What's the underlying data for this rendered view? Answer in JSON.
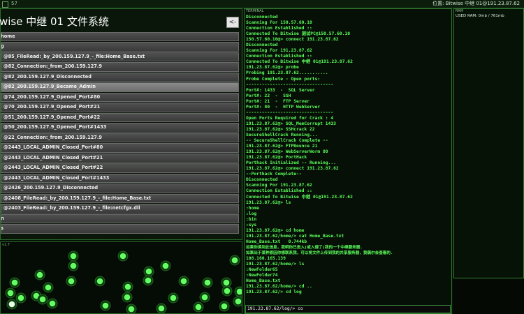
{
  "titlebar": {
    "left_text": "57",
    "right_text": "位置: Bitwise 中继 01@191.23.87.62"
  },
  "filesystem": {
    "title": "wise 中继 01 文件系统",
    "back_label": "<-",
    "rows": [
      {
        "label": "home",
        "depth": 0
      },
      {
        "label": "g",
        "depth": 0
      },
      {
        "label": "@85_FileRead:_by_200.159.127.9_-_file:Home_Base.txt",
        "depth": 1
      },
      {
        "label": "@82_Connection:_from_200.159.127.9",
        "depth": 1
      },
      {
        "label": "@82_200.159.127.9_Disconnected",
        "depth": 1
      },
      {
        "label": "@82_200.159.127.9_Became_Admin",
        "depth": 1,
        "selected": true
      },
      {
        "label": "@74_200.159.127.9_Opened_Port#80",
        "depth": 1
      },
      {
        "label": "@70_200.159.127.9_Opened_Port#21",
        "depth": 1
      },
      {
        "label": "@51_200.159.127.9_Opened_Port#22",
        "depth": 1
      },
      {
        "label": "@50_200.159.127.9_Opened_Port#1433",
        "depth": 1
      },
      {
        "label": "@22_Connection:_from_200.159.127.9",
        "depth": 1
      },
      {
        "label": "@2443_LOCAL_ADMIN_Closed_Port#80",
        "depth": 1
      },
      {
        "label": "@2443_LOCAL_ADMIN_Closed_Port#21",
        "depth": 1
      },
      {
        "label": "@2443_LOCAL_ADMIN_Closed_Port#22",
        "depth": 1
      },
      {
        "label": "@2443_LOCAL_ADMIN_Closed_Port#1433",
        "depth": 1
      },
      {
        "label": "@2426_200.159.127.9_Disconnected",
        "depth": 1
      },
      {
        "label": "@2408_FileRead:_by_200.159.127.9_-_file:Home_Base.txt",
        "depth": 1
      },
      {
        "label": "@2403_FileRead:_by_200.159.127.9_-_file:netcfgx.dll",
        "depth": 1
      },
      {
        "label": "n",
        "depth": 0
      },
      {
        "label": "s",
        "depth": 0
      }
    ]
  },
  "netmap": {
    "label": "v1.7"
  },
  "terminal": {
    "header": "TERMINAL",
    "lines": [
      "Disconnected",
      "Scanning For 150.57.60.10",
      "Connection Established ::",
      "Connected To Bitwise 测试PC@150.57.60.10",
      "150.57.60.10@> connect 191.23.87.62",
      "Disconnected",
      "Scanning For 191.23.87.62",
      "Connection Established ::",
      "Connected To Bitwise 中继 01@191.23.87.62",
      "191.23.87.62@> probe",
      "Probing 191.23.87.62...........",
      "Probe Complete - Open ports:",
      "---------------------------------",
      "Port#: 1433  -  SQL Server",
      "Port#: 22  -  SSH",
      "Port#: 21  -  FTP Server",
      "Port#: 80  -  HTTP WebServer",
      "---------------------------------",
      "Open Ports Required for Crack : 4",
      "191.23.87.62@> SQL_MemCorrupt 1433",
      "191.23.87.62@> SSHcrack 22",
      "SecureShellCrack Running...",
      "-- SecureShellCrack Complete --",
      "191.23.87.62@> FTPBounce 21",
      "191.23.87.62@> WebServerWorm 80",
      "191.23.87.62@> PortHack",
      "Porthack Initialized -- Running...",
      "191.23.87.62@> connect 191.23.87.62",
      "--Porthack Complete--",
      "Disconnected",
      "Scanning For 191.23.87.62",
      "Connection Established ::",
      "Connected To Bitwise 中继 01@191.23.87.62",
      "191.23.87.62@> ls",
      ":home",
      ":log",
      ":bin",
      ":sys",
      "191.23.87.62@> cd home",
      "191.23.87.62/home/> cat Home_Base.txt",
      "Home_Base.txt   0.744kb",
      "如果你读到此信息，我明你已进入(或入侵了)我的一个中继服务器.",
      "如果出于某种原因你想联系我，可以将文件上传到我的共享服务器，我偶尔会查看的.",
      "108.160.165.139",
      "191.23.87.62/home/> ls",
      ":NewFolder65",
      ":NewFolder74",
      "Home_Base.txt",
      "191.23.87.62/home/> cd ..",
      "191.23.87.62/> cd log"
    ],
    "prompt": "191.23.87.62/log/> co"
  },
  "ram": {
    "header": "RAM",
    "used": "USED RAM: 0mb / 761mb"
  }
}
